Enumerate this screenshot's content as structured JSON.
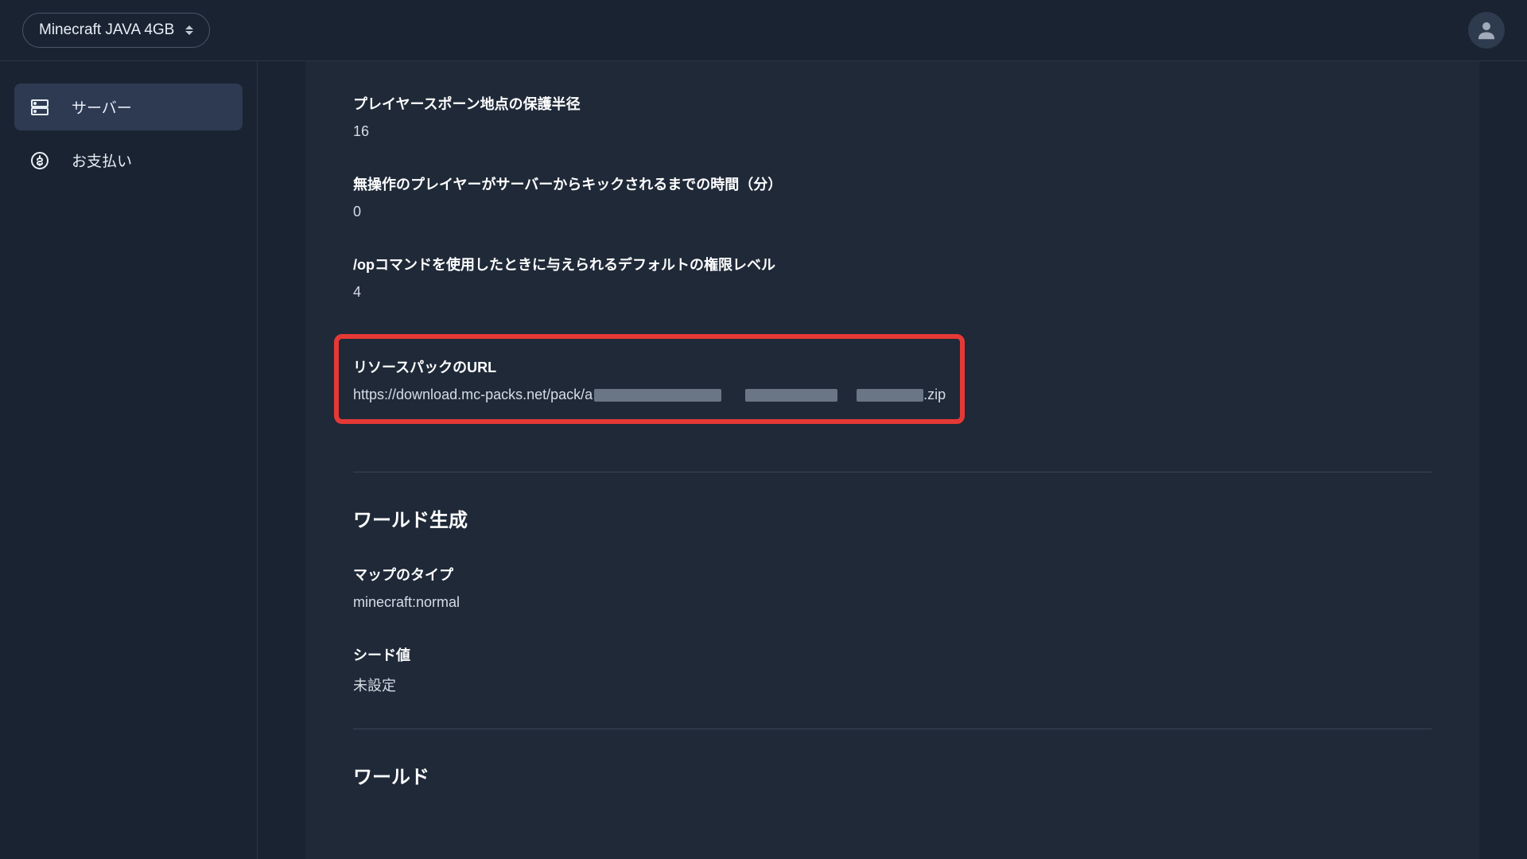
{
  "header": {
    "server_selector_label": "Minecraft JAVA 4GB"
  },
  "sidebar": {
    "items": [
      {
        "label": "サーバー",
        "icon": "server-icon",
        "active": true
      },
      {
        "label": "お支払い",
        "icon": "payment-icon",
        "active": false
      }
    ]
  },
  "settings": {
    "spawn_protection": {
      "label": "プレイヤースポーン地点の保護半径",
      "value": "16"
    },
    "idle_timeout": {
      "label": "無操作のプレイヤーがサーバーからキックされるまでの時間（分）",
      "value": "0"
    },
    "op_permission_level": {
      "label": "/opコマンドを使用したときに与えられるデフォルトの権限レベル",
      "value": "4"
    },
    "resource_pack_url": {
      "label": "リソースパックのURL",
      "url_prefix": "https://download.mc-packs.net/pack/a",
      "url_suffix": ".zip"
    }
  },
  "sections": {
    "world_gen": {
      "title": "ワールド生成",
      "map_type": {
        "label": "マップのタイプ",
        "value": "minecraft:normal"
      },
      "seed": {
        "label": "シード値",
        "value": "未設定"
      }
    },
    "world": {
      "title": "ワールド"
    }
  }
}
